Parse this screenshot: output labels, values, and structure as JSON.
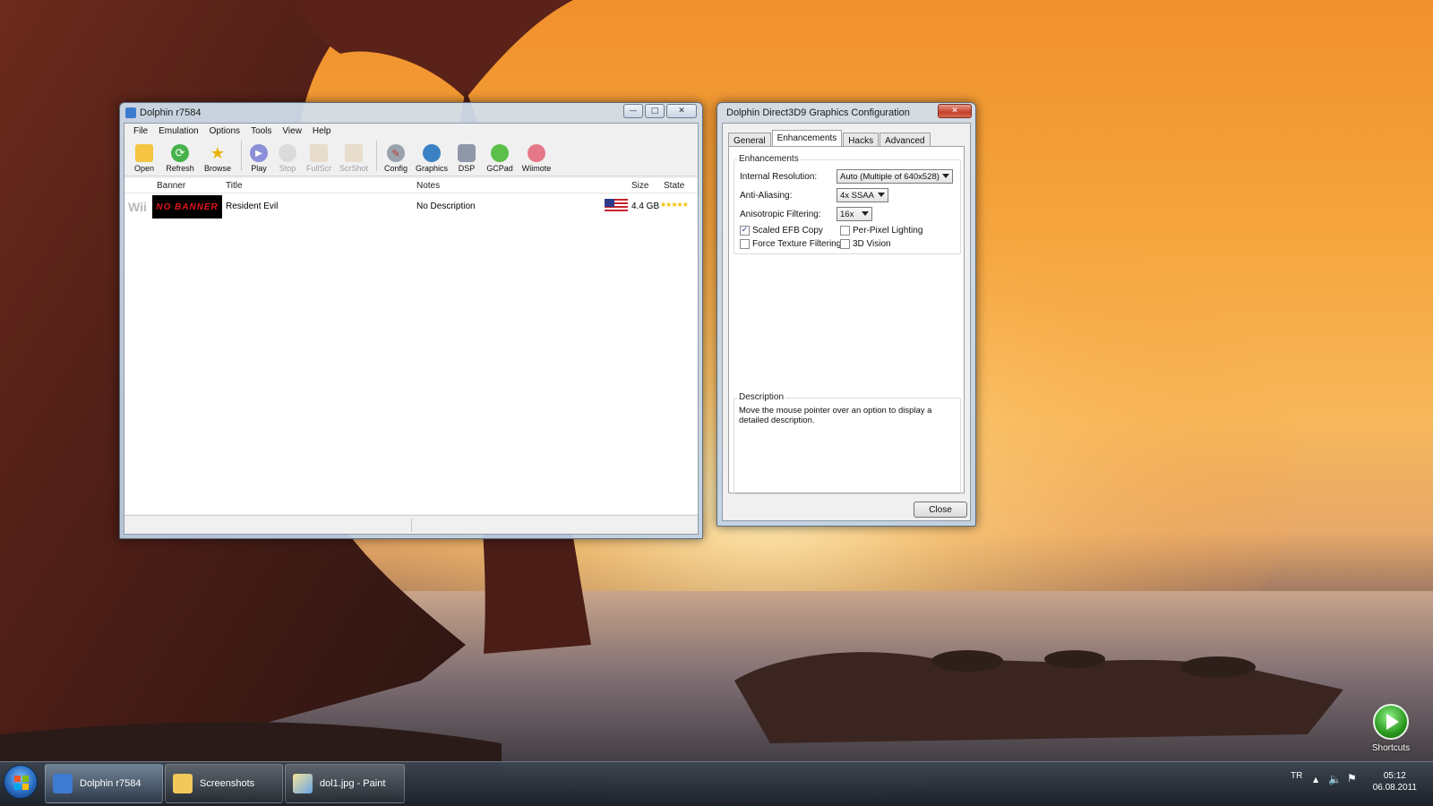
{
  "dolphin": {
    "title": "Dolphin r7584",
    "menu": [
      "File",
      "Emulation",
      "Options",
      "Tools",
      "View",
      "Help"
    ],
    "toolbar": [
      {
        "label": "Open",
        "icon": "open-folder-icon",
        "enabled": true
      },
      {
        "label": "Refresh",
        "icon": "refresh-icon",
        "enabled": true
      },
      {
        "label": "Browse",
        "icon": "star-icon",
        "enabled": true
      },
      {
        "label": "Play",
        "icon": "play-icon",
        "enabled": true
      },
      {
        "label": "Stop",
        "icon": "stop-icon",
        "enabled": false
      },
      {
        "label": "FullScr",
        "icon": "fullscreen-icon",
        "enabled": false
      },
      {
        "label": "ScrShot",
        "icon": "screenshot-icon",
        "enabled": false
      },
      {
        "label": "Config",
        "icon": "config-icon",
        "enabled": true
      },
      {
        "label": "Graphics",
        "icon": "graphics-icon",
        "enabled": true
      },
      {
        "label": "DSP",
        "icon": "dsp-icon",
        "enabled": true
      },
      {
        "label": "GCPad",
        "icon": "gcpad-icon",
        "enabled": true
      },
      {
        "label": "Wiimote",
        "icon": "wiimote-icon",
        "enabled": true
      }
    ],
    "columns": {
      "banner": "Banner",
      "title": "Title",
      "notes": "Notes",
      "size": "Size",
      "state": "State"
    },
    "games": [
      {
        "platform": "Wii",
        "banner": "NO BANNER",
        "title": "Resident Evil",
        "notes": "No Description",
        "region_flag": "usa-flag-icon",
        "size": "4.4 GB",
        "state_stars": 5
      }
    ]
  },
  "gfx": {
    "title": "Dolphin Direct3D9 Graphics Configuration",
    "tabs": [
      "General",
      "Enhancements",
      "Hacks",
      "Advanced"
    ],
    "active_tab": "Enhancements",
    "group_label": "Enhancements",
    "internal_resolution_label": "Internal Resolution:",
    "internal_resolution_value": "Auto (Multiple of 640x528)",
    "anti_aliasing_label": "Anti-Aliasing:",
    "anti_aliasing_value": "4x SSAA",
    "anisotropic_label": "Anisotropic Filtering:",
    "anisotropic_value": "16x",
    "checkboxes": [
      {
        "label": "Scaled EFB Copy",
        "checked": true
      },
      {
        "label": "Per-Pixel Lighting",
        "checked": false
      },
      {
        "label": "Force Texture Filtering",
        "checked": false
      },
      {
        "label": "3D Vision",
        "checked": false
      }
    ],
    "description_label": "Description",
    "description_text": "Move the mouse pointer over an option to display a detailed description.",
    "close_label": "Close"
  },
  "taskbar": {
    "items": [
      {
        "label": "Dolphin r7584",
        "icon": "dolphin-icon",
        "active": true
      },
      {
        "label": "Screenshots",
        "icon": "folder-icon",
        "active": false
      },
      {
        "label": "dol1.jpg - Paint",
        "icon": "paint-icon",
        "active": false
      }
    ],
    "language": "TR",
    "time": "05:12",
    "date": "06.08.2011"
  },
  "gadget": {
    "label": "Shortcuts"
  },
  "colors": {
    "accent": "#2a6cc0",
    "star": "#f2c200",
    "banner_bg": "#000000",
    "banner_text": "#e0151c"
  }
}
